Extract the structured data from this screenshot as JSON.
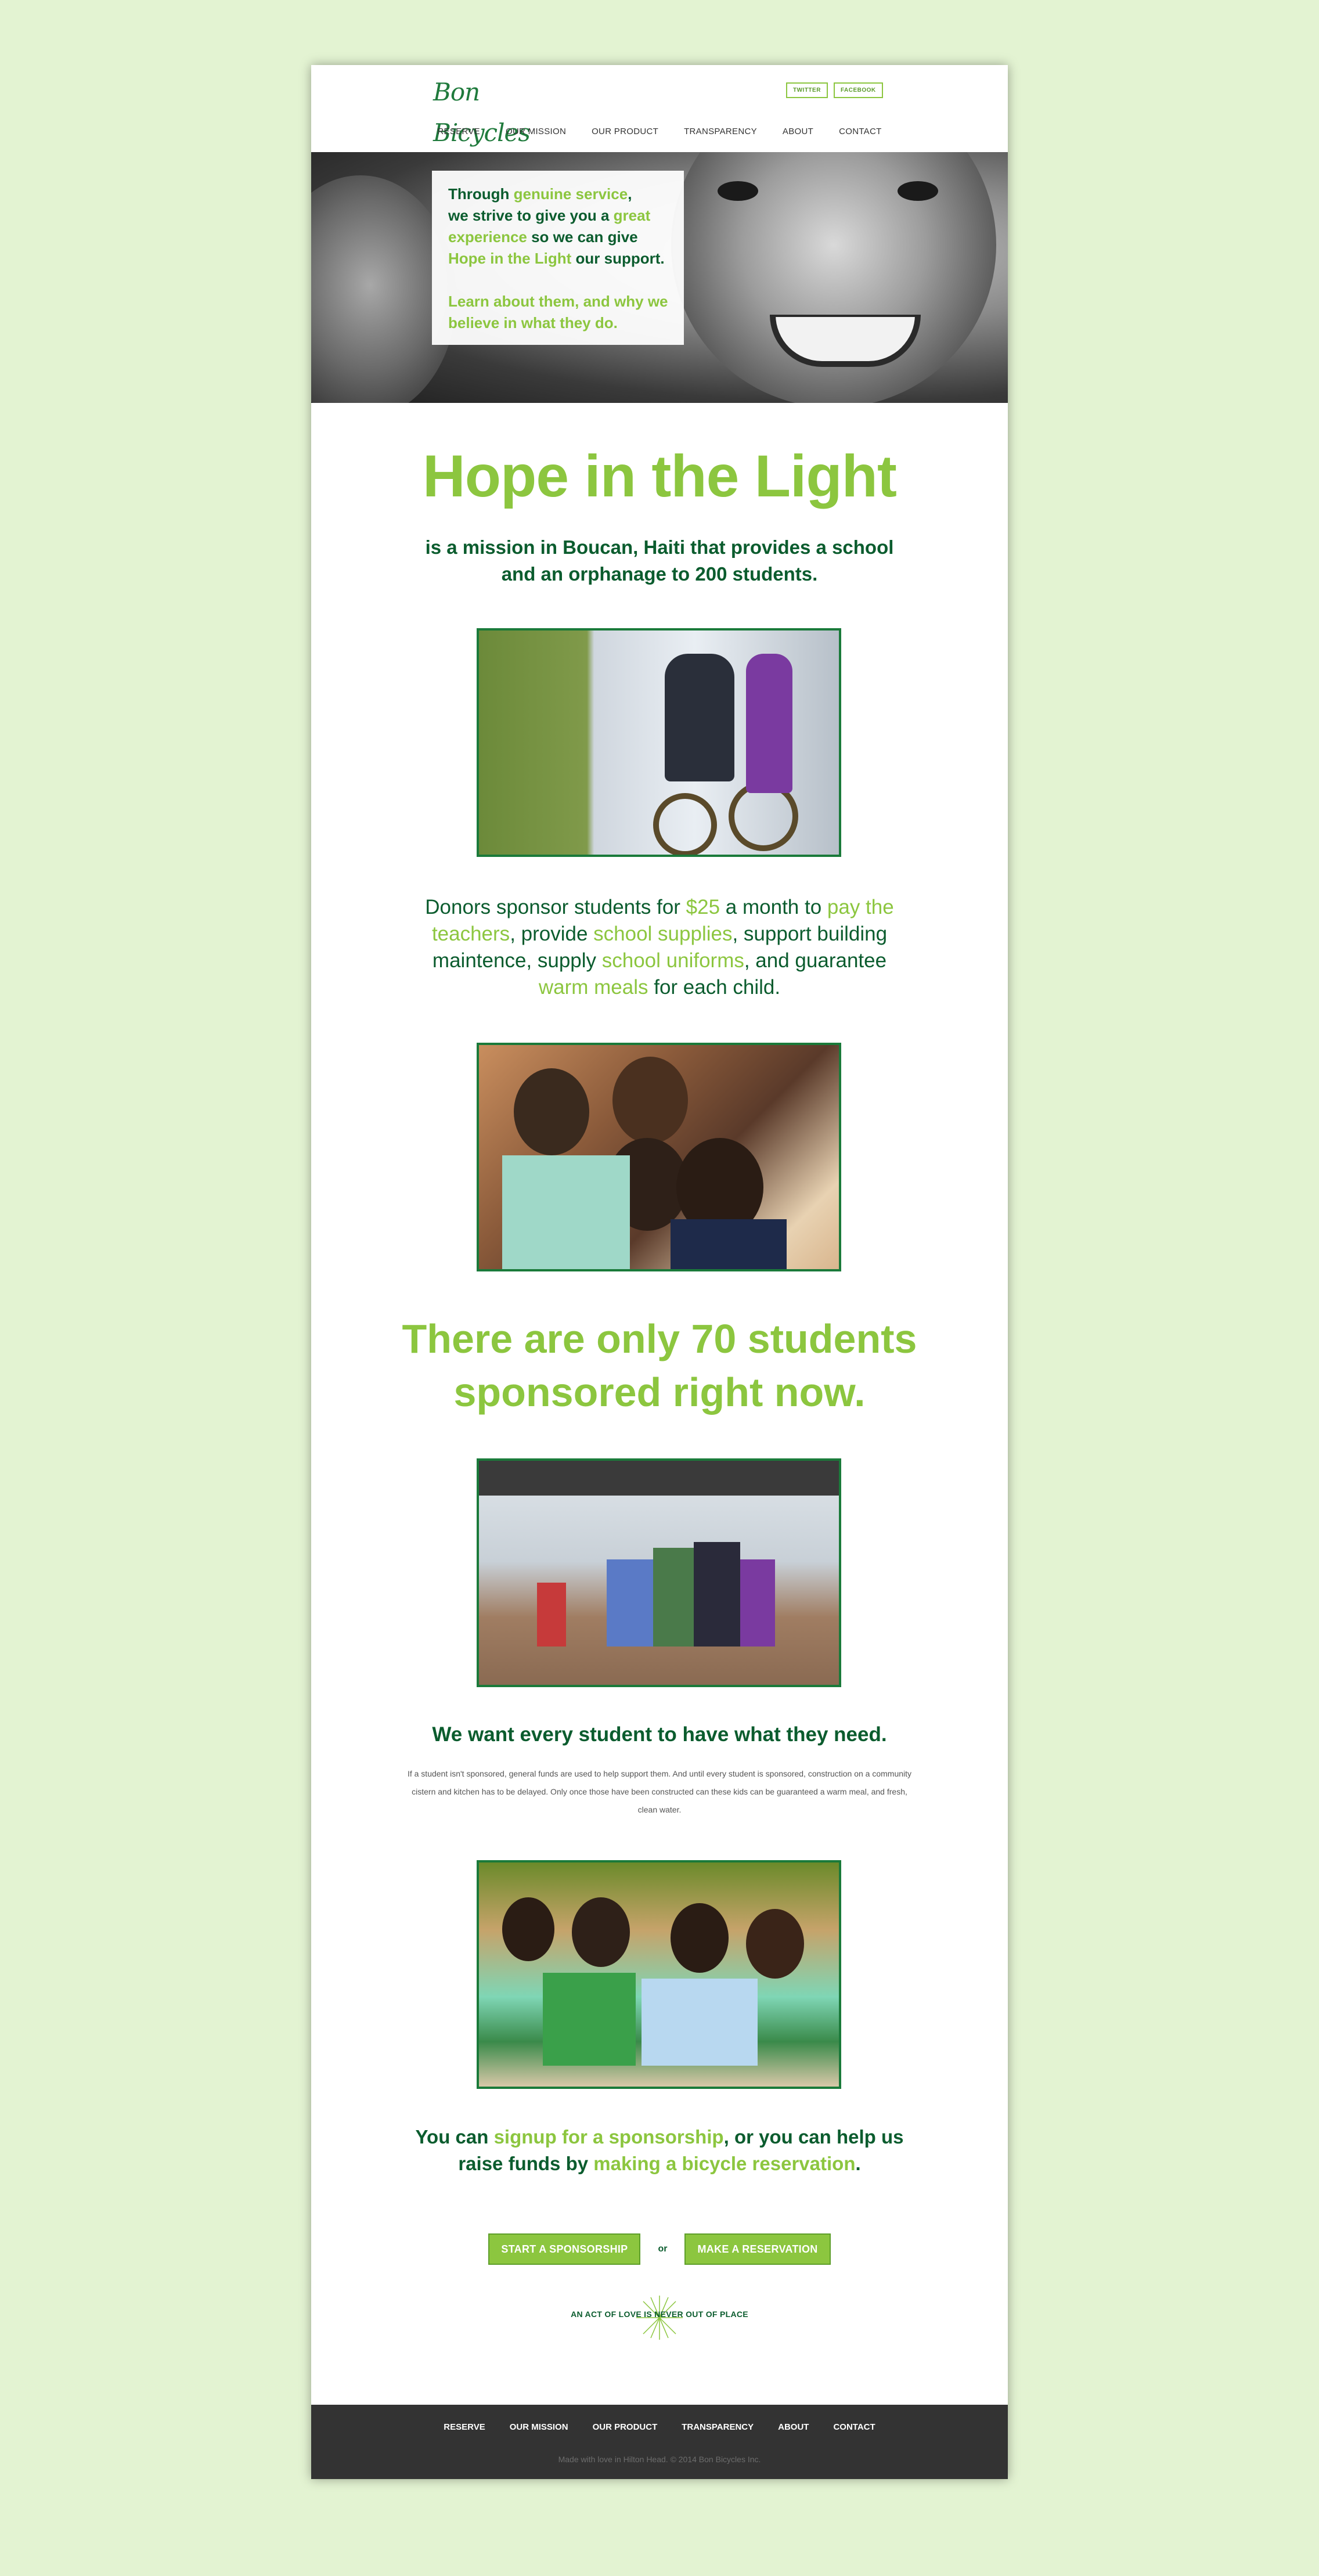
{
  "header": {
    "logo": "Bon Bicycles",
    "social": [
      "TWITTER",
      "FACEBOOK"
    ],
    "nav": [
      "RESERVE",
      "OUR MISSION",
      "OUR PRODUCT",
      "TRANSPARENCY",
      "ABOUT",
      "CONTACT"
    ]
  },
  "hero": {
    "line1_a": "Through ",
    "line1_b": "genuine service",
    "line1_c": ",",
    "line2_a": "we strive to give you a ",
    "line2_b": "great",
    "line3_a": "experience",
    "line3_b": " so we can give",
    "line4_a": "Hope in the Light",
    "line4_b": " our support.",
    "learn": "Learn about them, and why we believe in what they do."
  },
  "main": {
    "title": "Hope in the Light",
    "subtitle": "is a mission in Boucan, Haiti that provides a school and an orphanage to 200 students.",
    "donors": {
      "t1": "Donors sponsor students for ",
      "h1": "$25",
      "t2": " a month to ",
      "h2": "pay the teachers",
      "t3": ", provide ",
      "h3": "school supplies",
      "t4": ", support building maintence, supply ",
      "h4": "school uniforms",
      "t5": ", and guarantee ",
      "h5": "warm meals",
      "t6": " for each child."
    },
    "statement": "There are only 70 students sponsored right now.",
    "want": "We want every student to have what they need.",
    "small_para": "If a student isn't sponsored, general funds are used to help support them. And until every student is sponsored, construction on a community cistern and kitchen has to be delayed. Only once those have been constructed can these kids can be guaranteed a warm meal, and fresh, clean water.",
    "cta": {
      "t1": "You can ",
      "h1": "signup for a sponsorship",
      "t2": ", or you can help us raise funds by ",
      "h2": "making a bicycle reservation",
      "t3": "."
    },
    "buttons": {
      "sponsor": "START A SPONSORSHIP",
      "or": "or",
      "reserve": "MAKE A RESERVATION"
    },
    "tagline": "AN ACT OF LOVE IS NEVER OUT OF PLACE"
  },
  "footer": {
    "nav": [
      "RESERVE",
      "OUR MISSION",
      "OUR PRODUCT",
      "TRANSPARENCY",
      "ABOUT",
      "CONTACT"
    ],
    "copyright": "Made with love in Hilton Head. © 2014 Bon Bicycles Inc."
  },
  "colors": {
    "accent_green": "#8cc63f",
    "dark_green": "#0b5c2e",
    "background": "#e3f3d2",
    "footer": "#333333"
  }
}
